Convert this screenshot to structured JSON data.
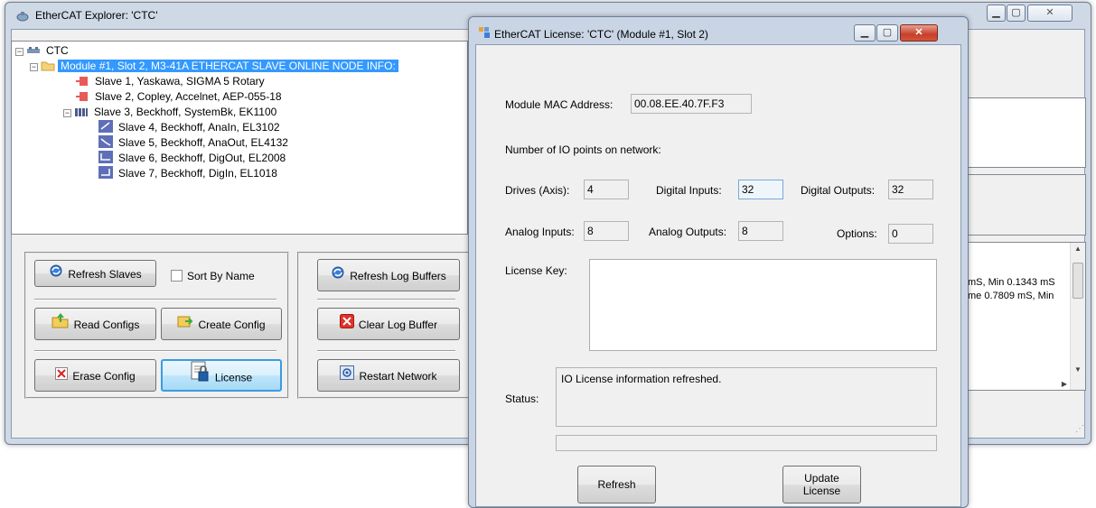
{
  "main": {
    "title": "EtherCAT Explorer: 'CTC'",
    "tree": {
      "root": "CTC",
      "module": "Module #1, Slot 2, M3-41A ETHERCAT SLAVE ONLINE NODE INFO:",
      "slaves": [
        "Slave 1, Yaskawa, SIGMA 5 Rotary",
        "Slave 2, Copley, Accelnet, AEP-055-18",
        "Slave 3, Beckhoff, SystemBk, EK1100",
        "Slave 4, Beckhoff, AnaIn, EL3102",
        "Slave 5, Beckhoff, AnaOut, EL4132",
        "Slave 6, Beckhoff, DigOut, EL2008",
        "Slave 7, Beckhoff, DigIn, EL1018"
      ]
    },
    "buttons": {
      "refresh_slaves": "Refresh Slaves",
      "sort_by_name": "Sort By Name",
      "read_configs": "Read Configs",
      "create_config": "Create Config",
      "erase_config": "Erase Config",
      "license": "License",
      "refresh_log_buffers": "Refresh Log Buffers",
      "clear_log_buffer": "Clear Log Buffer",
      "restart_network": "Restart Network"
    },
    "log_lines": [
      "mS, Min 0.1343 mS",
      "me 0.7809 mS, Min"
    ]
  },
  "dialog": {
    "title": "EtherCAT License: 'CTC' (Module #1, Slot 2)",
    "mac_label": "Module MAC Address:",
    "mac_value": "00.08.EE.40.7F.F3",
    "io_header": "Number of IO points on network:",
    "drives_label": "Drives (Axis):",
    "drives_value": "4",
    "digital_inputs_label": "Digital Inputs:",
    "digital_inputs_value": "32",
    "digital_outputs_label": "Digital Outputs:",
    "digital_outputs_value": "32",
    "analog_inputs_label": "Analog Inputs:",
    "analog_inputs_value": "8",
    "analog_outputs_label": "Analog Outputs:",
    "analog_outputs_value": "8",
    "options_label": "Options:",
    "options_value": "0",
    "license_key_label": "License Key:",
    "license_key_value": "",
    "status_label": "Status:",
    "status_value": "IO License information refreshed.",
    "refresh_button": "Refresh",
    "update_button_line1": "Update",
    "update_button_line2": "License"
  }
}
